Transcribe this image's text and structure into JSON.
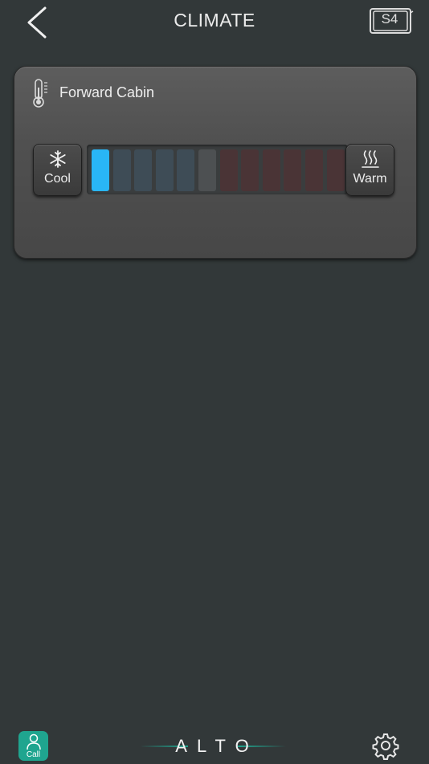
{
  "header": {
    "title": "CLIMATE",
    "back_icon": "chevron-left-icon",
    "scene_icon": "s4-icon",
    "scene_label": "S4"
  },
  "zone": {
    "name": "Forward Cabin",
    "icon": "thermometer-icon",
    "cool_button": {
      "label": "Cool",
      "icon": "snowflake-icon"
    },
    "warm_button": {
      "label": "Warm",
      "icon": "heat-waves-icon"
    },
    "level": {
      "selected_step": 1,
      "total_steps": 12,
      "neutral_step": 6
    },
    "colors": {
      "cool_active": "#29b6f6",
      "cool_inactive": "#3e4c56",
      "neutral": "#4d5052",
      "warm_inactive": "#4a3436"
    }
  },
  "footer": {
    "call_label": "Call",
    "call_icon": "person-icon",
    "logo_text": "ALTO",
    "settings_icon": "gear-icon",
    "accent_color": "#1fa58f"
  }
}
